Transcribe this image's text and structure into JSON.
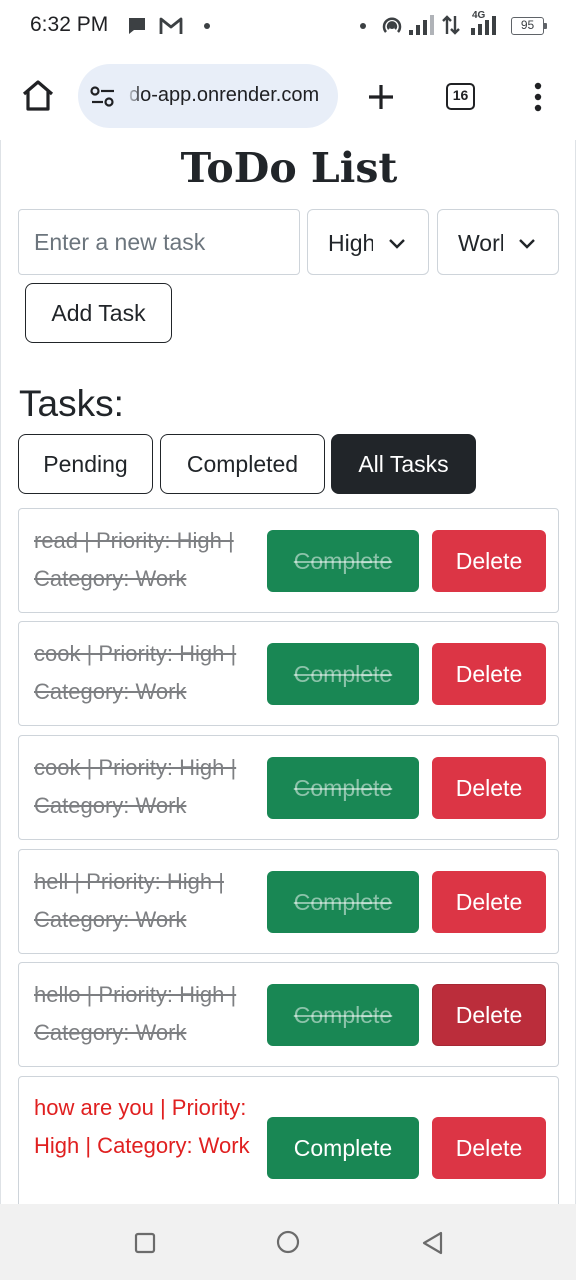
{
  "status_bar": {
    "time": "6:32 PM",
    "battery": "95",
    "network_label": "4G",
    "icons": [
      "chat-bubble-icon",
      "gmail-icon",
      "hotspot-icon",
      "signal-icon",
      "data-arrows-icon",
      "signal-4g-icon",
      "battery-icon"
    ]
  },
  "browser": {
    "url": "do-app.onrender.com",
    "tab_count": "16",
    "icons": [
      "home-icon",
      "site-settings-icon",
      "new-tab-plus-icon",
      "tab-switcher-icon",
      "more-vert-icon"
    ]
  },
  "app": {
    "title": "ToDo List",
    "input_placeholder": "Enter a new task",
    "priority_selected": "High",
    "category_selected": "Work",
    "add_button": "Add Task",
    "tasks_heading": "Tasks:",
    "filters": {
      "pending": "Pending",
      "completed": "Completed",
      "all": "All Tasks",
      "active": "All Tasks"
    },
    "tasks": [
      {
        "text": "read | Priority: High | Category: Work",
        "completed": true,
        "complete_label": "Complete",
        "delete_label": "Delete"
      },
      {
        "text": "cook | Priority: High | Category: Work",
        "completed": true,
        "complete_label": "Complete",
        "delete_label": "Delete"
      },
      {
        "text": "cook | Priority: High | Category: Work",
        "completed": true,
        "complete_label": "Complete",
        "delete_label": "Delete"
      },
      {
        "text": "hell | Priority: High | Category: Work",
        "completed": true,
        "complete_label": "Complete",
        "delete_label": "Delete"
      },
      {
        "text": "hello | Priority: High | Category: Work",
        "completed": true,
        "complete_label": "Complete",
        "delete_label": "Delete"
      },
      {
        "text": "how are you | Priority: High | Category: Work",
        "completed": false,
        "complete_label": "Complete",
        "delete_label": "Delete"
      }
    ]
  },
  "colors": {
    "success": "#198754",
    "danger": "#dc3545",
    "dark": "#212529",
    "pending_text": "#e02020",
    "completed_text": "#7d7f82"
  },
  "nav_bar": {
    "icons": [
      "recents-square-icon",
      "home-circle-icon",
      "back-triangle-icon"
    ]
  }
}
